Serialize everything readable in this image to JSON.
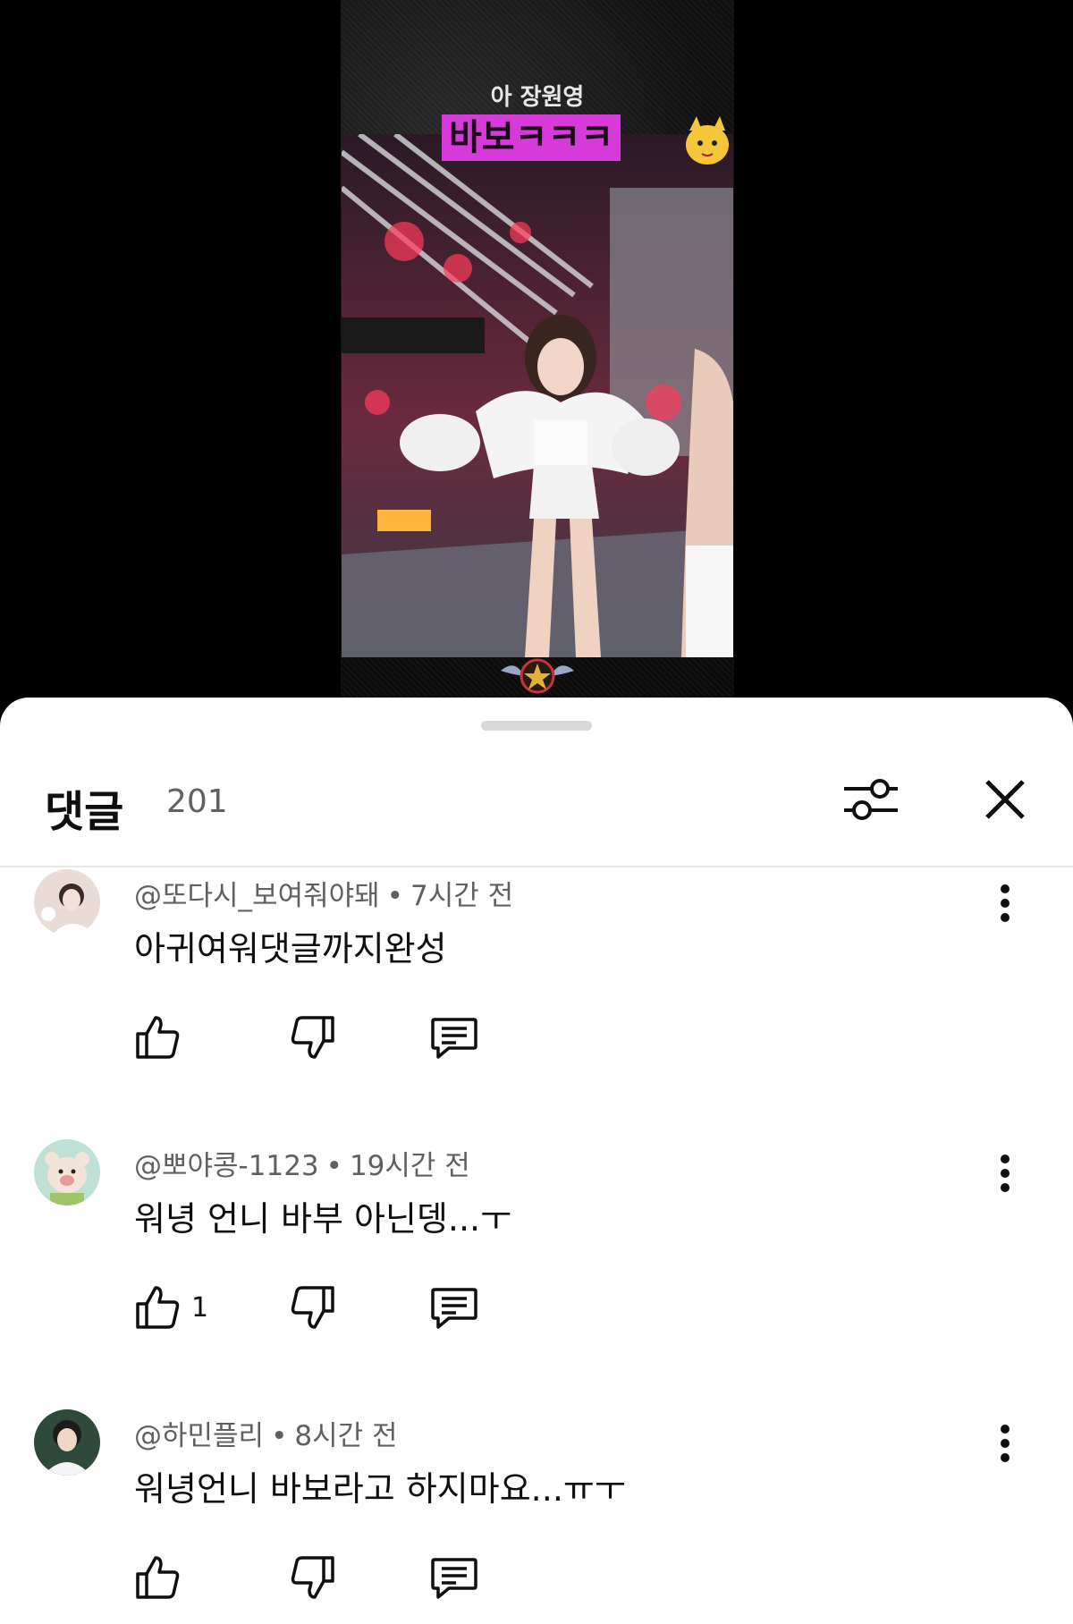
{
  "video": {
    "subtitle": "아 장원영",
    "title": "바보ㅋㅋㅋ"
  },
  "comments_sheet": {
    "title": "댓글",
    "count": "201",
    "filter_icon": "sliders-icon",
    "close_icon": "close-icon"
  },
  "comments": [
    {
      "author": "@또다시_보여줘야돼",
      "time": "7시간 전",
      "text": "아귀여워댓글까지완성",
      "likes": "",
      "avatar_color": "#e9dcd6"
    },
    {
      "author": "@뽀야콩-1123",
      "time": "19시간 전",
      "text": "워녕 언니 바부 아닌뎅...ㅜ",
      "likes": "1",
      "avatar_color": "#bfe0d5"
    },
    {
      "author": "@하민플리",
      "time": "8시간 전",
      "text": "워녕언니 바보라고 하지마요...ㅠㅜ",
      "likes": "",
      "avatar_color": "#2f4a3a"
    }
  ],
  "colors": {
    "accent_title_bg": "#d63ad8",
    "meta_text": "#606060",
    "primary_text": "#0f0f0f"
  }
}
